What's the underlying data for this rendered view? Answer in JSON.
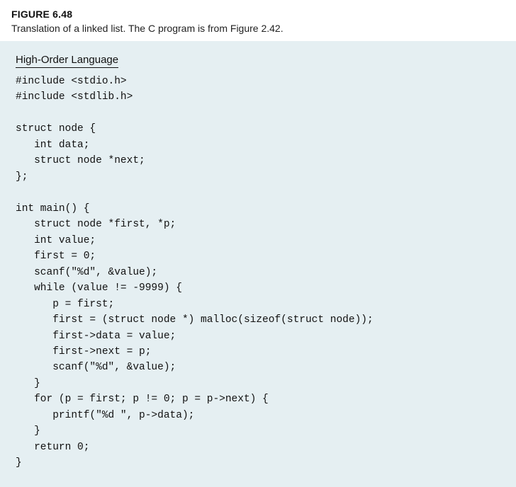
{
  "figure": {
    "label": "FIGURE 6.48",
    "caption": "Translation of a linked list. The C program is from Figure 2.42."
  },
  "section_title": "High-Order Language",
  "code": "#include <stdio.h>\n#include <stdlib.h>\n\nstruct node {\n   int data;\n   struct node *next;\n};\n\nint main() {\n   struct node *first, *p;\n   int value;\n   first = 0;\n   scanf(\"%d\", &value);\n   while (value != -9999) {\n      p = first;\n      first = (struct node *) malloc(sizeof(struct node));\n      first->data = value;\n      first->next = p;\n      scanf(\"%d\", &value);\n   }\n   for (p = first; p != 0; p = p->next) {\n      printf(\"%d \", p->data);\n   }\n   return 0;\n}"
}
